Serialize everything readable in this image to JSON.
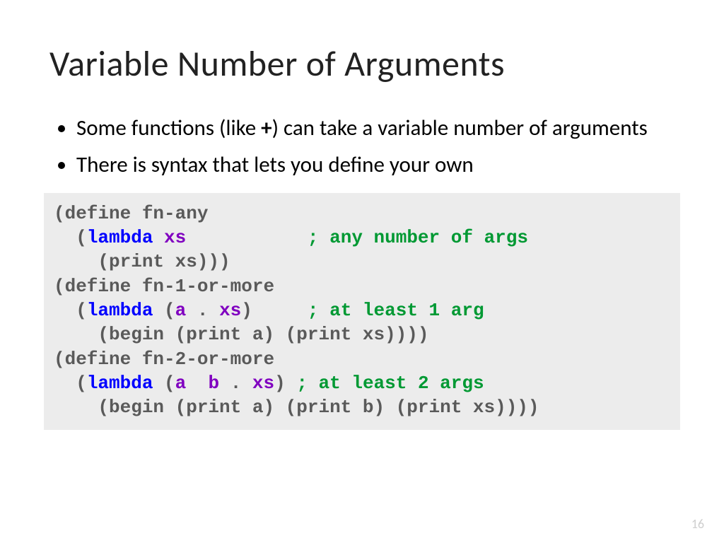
{
  "title": "Variable Number of Arguments",
  "bullets": {
    "b0_pre": "Some functions (like ",
    "b0_bold": "+",
    "b0_post": ") can take a variable number of arguments",
    "b1": "There is syntax that lets you define your own"
  },
  "code": {
    "l1": "(define fn-any",
    "l2a": "  (",
    "l2_lambda": "lambda",
    "l2b": " ",
    "l2_xs": "xs",
    "l2_pad": "           ",
    "l2_cmt": "; any number of args",
    "l3": "    (print xs)))",
    "l4": "(define fn-1-or-more",
    "l5a": "  (",
    "l5_lambda": "lambda",
    "l5b": " (",
    "l5_a": "a",
    "l5c": " . ",
    "l5_xs": "xs",
    "l5d": ")",
    "l5_pad": "     ",
    "l5_cmt": "; at least 1 arg",
    "l6": "    (begin (print a) (print xs))))",
    "l7": "(define fn-2-or-more",
    "l8a": "  (",
    "l8_lambda": "lambda",
    "l8b": " (",
    "l8_a": "a",
    "l8c": "  ",
    "l8_b": "b",
    "l8d": " . ",
    "l8_xs": "xs",
    "l8e": ") ",
    "l8_cmt": "; at least 2 args",
    "l9": "    (begin (print a) (print b) (print xs))))"
  },
  "page_number": "16"
}
